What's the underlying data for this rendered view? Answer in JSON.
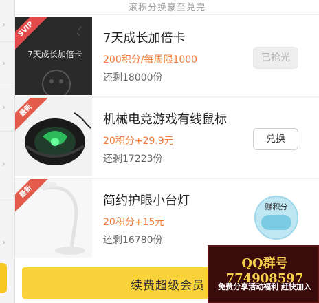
{
  "header": {
    "text": "滚积分换豪至兑完"
  },
  "items": [
    {
      "ribbon": "SVIP",
      "thumb_text": "7天成长加倍卡",
      "title": "7天成长加倍卡",
      "price": "200积分/每周限1000",
      "remaining": "还剩18000份",
      "button": "已抢光",
      "button_state": "soldout"
    },
    {
      "ribbon": "最新",
      "title": "机械电竞游戏有线鼠标",
      "price": "20积分+29.9元",
      "remaining": "还剩17223份",
      "button": "兑换",
      "button_state": "active"
    },
    {
      "ribbon": "最新",
      "title": "简约护眼小台灯",
      "price": "20积分+15元",
      "remaining": "还剩16780份",
      "badge": "赚积分"
    }
  ],
  "bottom": {
    "renew_label": "续费超级会员"
  },
  "overlay": {
    "line1": "QQ群号774908597",
    "line2": "免费分享活动福利 赶快加入"
  },
  "colors": {
    "accent_yellow": "#fad33a",
    "price_orange": "#f07a38",
    "ribbon_red": "#e44a4a",
    "badge_blue": "#bfe6f3"
  }
}
